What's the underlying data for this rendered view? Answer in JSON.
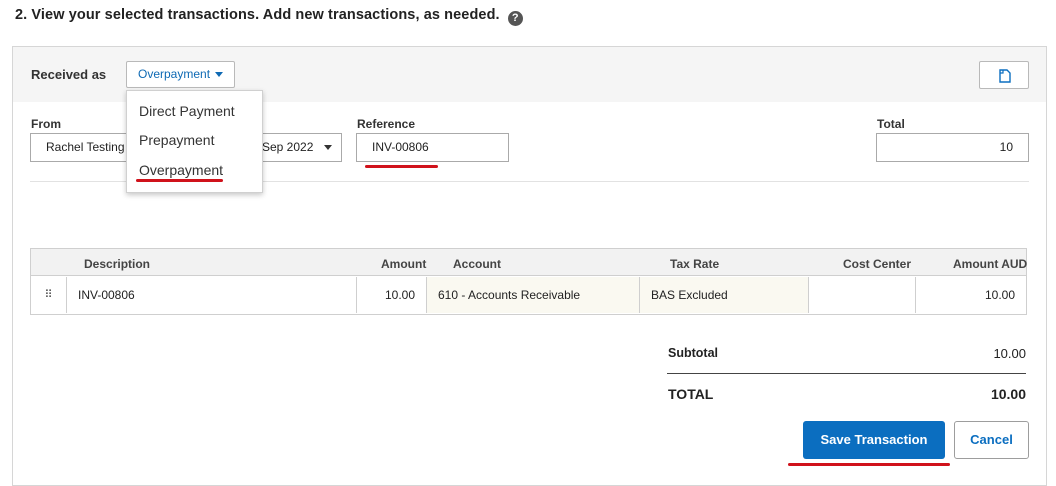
{
  "heading": {
    "text": "2. View your selected transactions. Add new transactions, as needed.",
    "help_icon": "?"
  },
  "received_as": {
    "label": "Received as",
    "selected": "Overpayment",
    "options": [
      "Direct Payment",
      "Prepayment",
      "Overpayment"
    ]
  },
  "from": {
    "label": "From",
    "value": "Rachel Testing"
  },
  "date": {
    "value": "Sep 2022"
  },
  "reference": {
    "label": "Reference",
    "value": "INV-00806"
  },
  "total_field": {
    "label": "Total",
    "value": "10"
  },
  "table": {
    "columns": [
      "Description",
      "Amount",
      "Account",
      "Tax Rate",
      "Cost Center",
      "Amount AUD"
    ],
    "rows": [
      {
        "drag": "⠿",
        "description": "INV-00806",
        "amount": "10.00",
        "account": "610 - Accounts Receivable",
        "tax_rate": "BAS Excluded",
        "cost_center": "",
        "amount_aud": "10.00"
      }
    ]
  },
  "summary": {
    "subtotal_label": "Subtotal",
    "subtotal_value": "10.00",
    "total_label": "TOTAL",
    "total_value": "10.00"
  },
  "buttons": {
    "save": "Save Transaction",
    "cancel": "Cancel"
  },
  "colors": {
    "accent": "#0b6ec0",
    "highlight": "#d0121b",
    "link": "#0f6ab4"
  }
}
